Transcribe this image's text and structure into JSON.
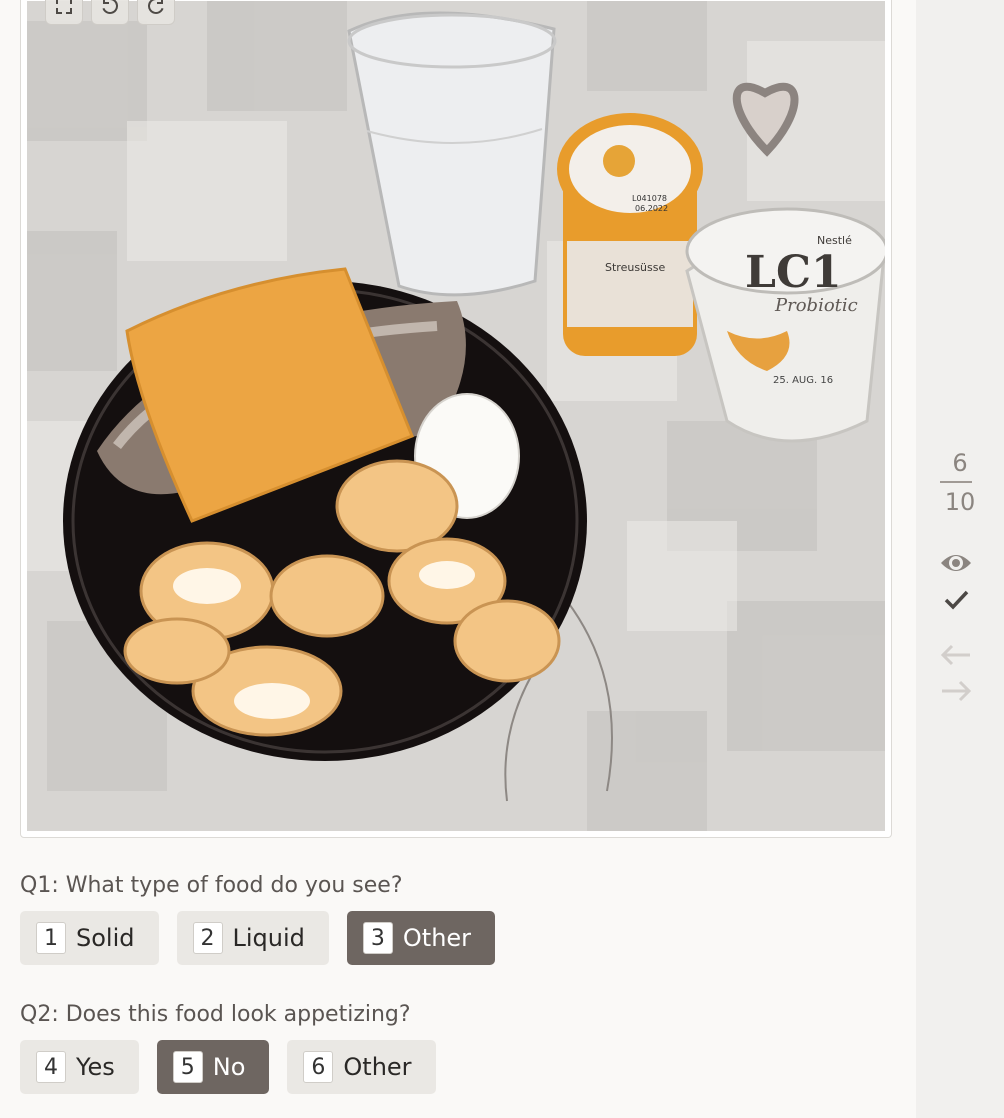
{
  "task": {
    "questions": [
      {
        "text": "Q1: What type of food do you see?",
        "options": [
          {
            "key": "1",
            "label": "Solid",
            "selected": false
          },
          {
            "key": "2",
            "label": "Liquid",
            "selected": false
          },
          {
            "key": "3",
            "label": "Other",
            "selected": true
          }
        ]
      },
      {
        "text": "Q2: Does this food look appetizing?",
        "options": [
          {
            "key": "4",
            "label": "Yes",
            "selected": false
          },
          {
            "key": "5",
            "label": "No",
            "selected": true
          },
          {
            "key": "6",
            "label": "Other",
            "selected": false
          }
        ]
      }
    ]
  },
  "image": {
    "toolbar": [
      "fullscreen-icon",
      "rotate-left-icon",
      "rotate-right-icon"
    ],
    "printed_text": {
      "cup_brand": "Nestlé",
      "cup_logo": "LC1",
      "cup_subtitle": "Probiotic",
      "cup_date": "25. AUG. 16",
      "bottle_label": "Streusüsse",
      "bottle_code": "L041078",
      "bottle_date": "06.2022"
    }
  },
  "sidebar": {
    "progress_current": "6",
    "progress_total": "10",
    "icons": [
      "eye-icon",
      "check-icon",
      "arrow-left-icon",
      "arrow-right-icon"
    ]
  },
  "colors": {
    "selected_option": "#6e6661",
    "option": "#eae8e4",
    "cheese": "#eca543",
    "plate": "#151010"
  }
}
